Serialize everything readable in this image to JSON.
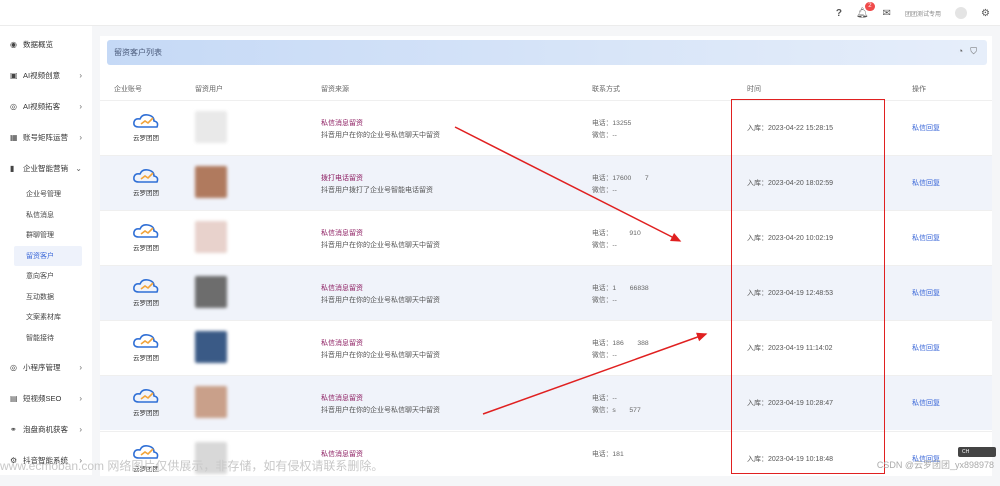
{
  "topbar": {
    "help_icon": "question-icon",
    "notification_count": "2",
    "user_name": "团团测试专用"
  },
  "sidebar": {
    "items": [
      {
        "label": "数据概览",
        "icon": "dashboard-icon"
      },
      {
        "label": "AI视频创意",
        "icon": "film-icon",
        "arrow": "›"
      },
      {
        "label": "AI视频拓客",
        "icon": "target-icon",
        "arrow": "›"
      },
      {
        "label": "账号矩阵运营",
        "icon": "grid-icon",
        "arrow": "›"
      },
      {
        "label": "企业智能营销",
        "icon": "chart-icon",
        "arrow": "⌄"
      }
    ],
    "subitems": [
      "企业号管理",
      "私信消息",
      "群聊管理",
      "留资客户",
      "意向客户",
      "互动数据",
      "文案素材库",
      "智能接待"
    ],
    "items_bottom": [
      {
        "label": "小程序管理",
        "icon": "miniapp-icon",
        "arrow": "›"
      },
      {
        "label": "短视频SEO",
        "icon": "seo-icon",
        "arrow": "›"
      },
      {
        "label": "泡盘商机获客",
        "icon": "link-icon",
        "arrow": "›"
      },
      {
        "label": "抖音智能系统",
        "icon": "gear-icon",
        "arrow": "›"
      }
    ]
  },
  "panel": {
    "title": "留资客户列表"
  },
  "table": {
    "headers": [
      "企业账号",
      "留资用户",
      "留资来源",
      "联系方式",
      "时间",
      "操作"
    ],
    "rows": [
      {
        "company": "云罗团团",
        "source_title": "私信消息留资",
        "source_desc": "抖音用户在你的企业号私信聊天中留资",
        "phone": "电话：13255",
        "wechat": "微信：--",
        "time": "入库：2023-04-22 15:28:15",
        "op": "私信回复",
        "avatar_color": "#e9e9e9"
      },
      {
        "company": "云罗团团",
        "source_title": "拨打电话留资",
        "source_desc": "抖音用户拨打了企业号智能电话留资",
        "phone": "电话：17600　　7",
        "wechat": "微信：--",
        "time": "入库：2023-04-20 18:02:59",
        "op": "私信回复",
        "avatar_color": "#b07a5e"
      },
      {
        "company": "云罗团团",
        "source_title": "私信消息留资",
        "source_desc": "抖音用户在你的企业号私信聊天中留资",
        "phone": "电话：　　　910",
        "wechat": "微信：--",
        "time": "入库：2023-04-20 10:02:19",
        "op": "私信回复",
        "avatar_color": "#e8d2cc"
      },
      {
        "company": "云罗团团",
        "source_title": "私信消息留资",
        "source_desc": "抖音用户在你的企业号私信聊天中留资",
        "phone": "电话：1　　66838",
        "wechat": "微信：--",
        "time": "入库：2023-04-19 12:48:53",
        "op": "私信回复",
        "avatar_color": "#6d6d6d"
      },
      {
        "company": "云罗团团",
        "source_title": "私信消息留资",
        "source_desc": "抖音用户在你的企业号私信聊天中留资",
        "phone": "电话：186　　388",
        "wechat": "微信：--",
        "time": "入库：2023-04-19 11:14:02",
        "op": "私信回复",
        "avatar_color": "#3a5a86"
      },
      {
        "company": "云罗团团",
        "source_title": "私信消息留资",
        "source_desc": "抖音用户在你的企业号私信聊天中留资",
        "phone": "电话：--",
        "wechat": "微信：s　　577",
        "time": "入库：2023-04-19 10:28:47",
        "op": "私信回复",
        "avatar_color": "#c9a08a"
      },
      {
        "company": "云罗团团",
        "source_title": "私信消息留资",
        "source_desc": "",
        "phone": "电话：181",
        "wechat": "",
        "time": "入库：2023-04-19 10:18:48",
        "op": "私信回复",
        "avatar_color": "#d8d8d8"
      }
    ]
  },
  "overlay": {
    "watermark": "www.ecmoban.com 网络图片仅供展示，非存储，如有侵权请联系删除。",
    "credit": "CSDN @云罗团团_yx898978",
    "badge": "CH"
  },
  "colors": {
    "accent": "#3a67d8",
    "source": "#8d1e62",
    "annotation": "#e02020"
  }
}
